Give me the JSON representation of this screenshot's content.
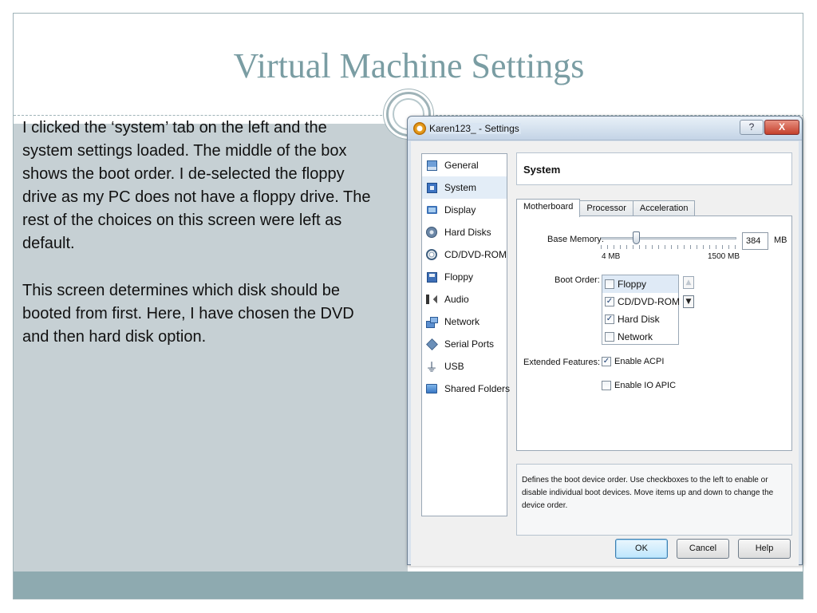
{
  "slide": {
    "title": "Virtual Machine Settings",
    "paragraphs": [
      "I clicked the ‘system’ tab on the left and the system settings loaded.  The middle of the box shows the boot order.  I de-selected the floppy drive as my PC does not have a floppy drive.  The rest of the choices on this screen were left as default.",
      "This screen determines which disk should be booted from first.  Here, I have chosen the DVD and then hard disk option."
    ]
  },
  "dialog": {
    "title": "Karen123_ - Settings",
    "help_glyph": "?",
    "close_glyph": "X",
    "nav": [
      {
        "label": "General",
        "icon": "general-icon"
      },
      {
        "label": "System",
        "icon": "system-icon",
        "selected": true
      },
      {
        "label": "Display",
        "icon": "display-icon"
      },
      {
        "label": "Hard Disks",
        "icon": "hard-disk-icon"
      },
      {
        "label": "CD/DVD-ROM",
        "icon": "cd-icon"
      },
      {
        "label": "Floppy",
        "icon": "floppy-icon"
      },
      {
        "label": "Audio",
        "icon": "audio-icon"
      },
      {
        "label": "Network",
        "icon": "network-icon"
      },
      {
        "label": "Serial Ports",
        "icon": "serial-port-icon"
      },
      {
        "label": "USB",
        "icon": "usb-icon"
      },
      {
        "label": "Shared Folders",
        "icon": "shared-folder-icon"
      }
    ],
    "section_title": "System",
    "tabs": [
      {
        "label": "Motherboard",
        "active": true
      },
      {
        "label": "Processor"
      },
      {
        "label": "Acceleration"
      }
    ],
    "motherboard": {
      "base_memory_label": "Base Memory:",
      "base_memory_value": "384",
      "base_memory_unit": "MB",
      "slider_min_label": "4 MB",
      "slider_max_label": "1500 MB",
      "slider_min": 4,
      "slider_max": 1500,
      "slider_value": 384,
      "boot_order_label": "Boot Order:",
      "boot_order": [
        {
          "label": "Floppy",
          "checked": false,
          "selected": true
        },
        {
          "label": "CD/DVD-ROM",
          "checked": true
        },
        {
          "label": "Hard Disk",
          "checked": true
        },
        {
          "label": "Network",
          "checked": false
        }
      ],
      "move_up_glyph": "▲",
      "move_down_glyph": "▼",
      "extended_features_label": "Extended Features:",
      "enable_acpi_label": "Enable ACPI",
      "enable_acpi_checked": true,
      "enable_ioapic_label": "Enable IO APIC",
      "enable_ioapic_checked": false
    },
    "description": "Defines the boot device order. Use checkboxes to the left to enable or disable individual boot devices. Move items up and down to change the device order.",
    "buttons": {
      "ok": "OK",
      "cancel": "Cancel",
      "help": "Help"
    }
  },
  "colors": {
    "title": "#7a9da3",
    "left_panel": "#c6d0d4",
    "bottom_band": "#8eaab0",
    "frame": "#9fb3b8"
  }
}
